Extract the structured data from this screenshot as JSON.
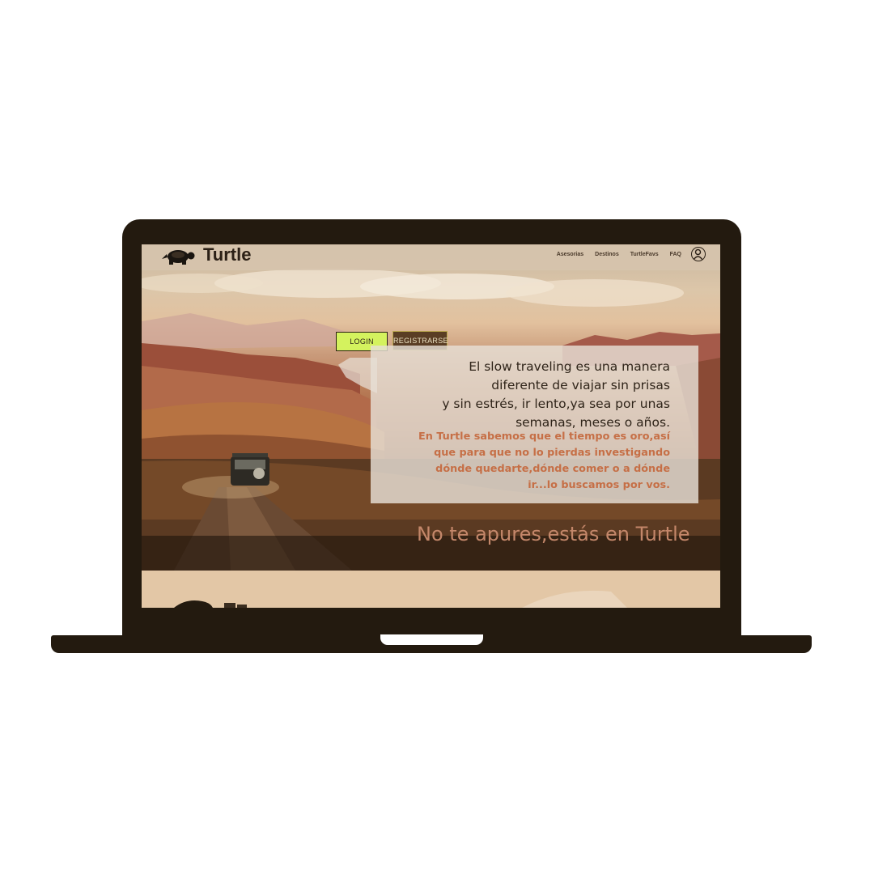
{
  "brand": {
    "name": "Turtle",
    "logo_icon": "turtle-icon"
  },
  "nav": {
    "links": [
      "Asesorias",
      "Destinos",
      "TurtleFavs",
      "FAQ"
    ],
    "user_icon": "user-icon"
  },
  "auth": {
    "login_label": "LOGIN",
    "register_label": "REGISTRARSE"
  },
  "hero": {
    "intro_lines": [
      "El slow traveling es una manera",
      "diferente de viajar sin prisas",
      "y sin estrés, ir lento,ya sea por unas",
      "semanas, meses o años."
    ],
    "promo_lines": [
      "En Turtle sabemos que el tiempo es oro,así",
      "que para que no lo  pierdas investigando",
      "dónde quedarte,dónde comer o a dónde",
      "ir...lo buscamos por vos."
    ],
    "tagline": "No te apures,estás en Turtle"
  },
  "colors": {
    "frame": "#231a0f",
    "login_bg": "#d4f25e",
    "register_bg": "#5a3e24",
    "promo_text": "#c66f46",
    "tagline_text": "#c4876a"
  }
}
